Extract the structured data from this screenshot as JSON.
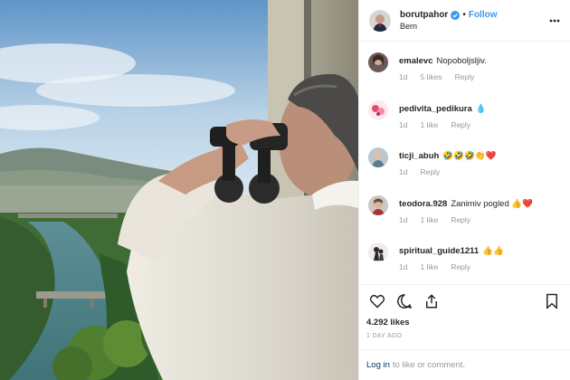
{
  "post": {
    "username": "borutpahor",
    "follow_label": "Follow",
    "location": "Bern",
    "likes": "4.292 likes",
    "time_ago": "1 DAY AGO",
    "login_link": "Log in",
    "login_suffix": "to like or comment."
  },
  "comments": [
    {
      "user": "emalevc",
      "text": "Nopoboljsljiv.",
      "age": "1d",
      "likes": "5 likes",
      "reply": "Reply"
    },
    {
      "user": "pedivita_pedikura",
      "text": "💧",
      "age": "1d",
      "likes": "1 like",
      "reply": "Reply"
    },
    {
      "user": "ticji_abuh",
      "text": "🤣🤣🤣👏❤️",
      "age": "1d",
      "likes": "",
      "reply": "Reply"
    },
    {
      "user": "teodora.928",
      "text": "Zanimiv pogled 👍❤️",
      "age": "1d",
      "likes": "1 like",
      "reply": "Reply"
    },
    {
      "user": "spiritual_guide1211",
      "text": "👍👍",
      "age": "1d",
      "likes": "1 like",
      "reply": "Reply"
    }
  ],
  "icons": {
    "verified": "verified-badge-icon",
    "more": "more-options-icon",
    "like": "heart-icon",
    "comment": "comment-icon",
    "share": "share-icon",
    "save": "bookmark-icon"
  },
  "colors": {
    "link": "#3897f0",
    "verified": "#3897f0",
    "muted": "#999999",
    "text": "#262626"
  }
}
